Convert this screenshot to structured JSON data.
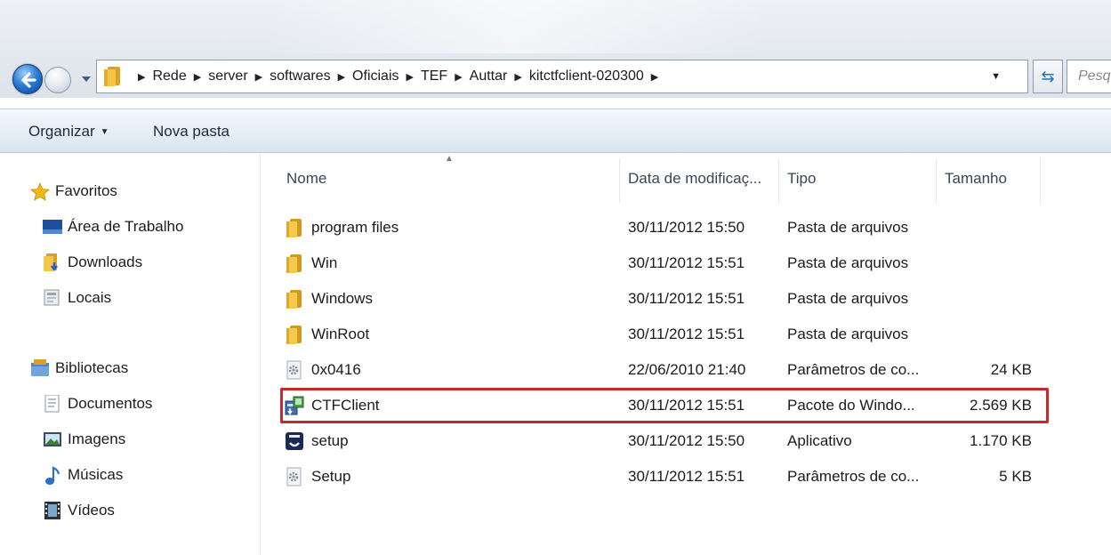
{
  "address": {
    "crumbs": [
      "Rede",
      "server",
      "softwares",
      "Oficiais",
      "TEF",
      "Auttar",
      "kitctfclient-020300"
    ],
    "search_placeholder": "Pesq"
  },
  "toolbar": {
    "organize_label": "Organizar",
    "new_folder_label": "Nova pasta"
  },
  "nav": {
    "favorites": "Favoritos",
    "desktop": "Área de Trabalho",
    "downloads": "Downloads",
    "locais": "Locais",
    "libraries": "Bibliotecas",
    "documents": "Documentos",
    "images": "Imagens",
    "music": "Músicas",
    "videos": "Vídeos"
  },
  "columns": {
    "name": "Nome",
    "date": "Data de modificaç...",
    "type": "Tipo",
    "size": "Tamanho"
  },
  "files": [
    {
      "name": "program files",
      "date": "30/11/2012 15:50",
      "type": "Pasta de arquivos",
      "size": "",
      "icon": "folder-icon"
    },
    {
      "name": "Win",
      "date": "30/11/2012 15:51",
      "type": "Pasta de arquivos",
      "size": "",
      "icon": "folder-icon"
    },
    {
      "name": "Windows",
      "date": "30/11/2012 15:51",
      "type": "Pasta de arquivos",
      "size": "",
      "icon": "folder-icon"
    },
    {
      "name": "WinRoot",
      "date": "30/11/2012 15:51",
      "type": "Pasta de arquivos",
      "size": "",
      "icon": "folder-icon"
    },
    {
      "name": "0x0416",
      "date": "22/06/2010 21:40",
      "type": "Parâmetros de co...",
      "size": "24 KB",
      "icon": "config-file-icon"
    },
    {
      "name": "CTFClient",
      "date": "30/11/2012 15:51",
      "type": "Pacote do Windo...",
      "size": "2.569 KB",
      "icon": "installer-package-icon"
    },
    {
      "name": "setup",
      "date": "30/11/2012 15:50",
      "type": "Aplicativo",
      "size": "1.170 KB",
      "icon": "setup-app-icon"
    },
    {
      "name": "Setup",
      "date": "30/11/2012 15:51",
      "type": "Parâmetros de co...",
      "size": "5 KB",
      "icon": "config-file-icon"
    }
  ],
  "colors": {
    "highlight": "#c9282b",
    "toolbar_bg": "#e7eef7"
  }
}
